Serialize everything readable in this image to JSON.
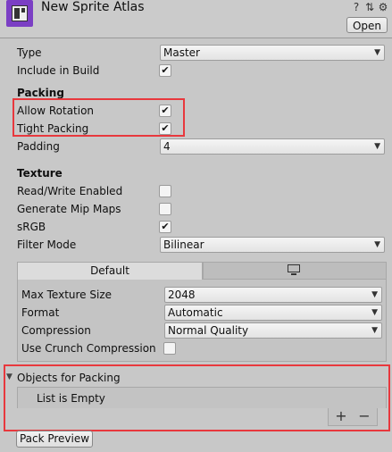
{
  "header": {
    "title": "New Sprite Atlas",
    "icons": [
      "help-icon",
      "preset-icon",
      "gear-icon"
    ],
    "open_label": "Open"
  },
  "properties": {
    "type": {
      "label": "Type",
      "value": "Master"
    },
    "include_in_build": {
      "label": "Include in Build",
      "checked": true
    }
  },
  "packing": {
    "heading": "Packing",
    "allow_rotation": {
      "label": "Allow Rotation",
      "checked": true
    },
    "tight_packing": {
      "label": "Tight Packing",
      "checked": true
    },
    "padding": {
      "label": "Padding",
      "value": "4"
    }
  },
  "texture": {
    "heading": "Texture",
    "read_write": {
      "label": "Read/Write Enabled",
      "checked": false
    },
    "mip_maps": {
      "label": "Generate Mip Maps",
      "checked": false
    },
    "srgb": {
      "label": "sRGB",
      "checked": true
    },
    "filter_mode": {
      "label": "Filter Mode",
      "value": "Bilinear"
    }
  },
  "platform": {
    "tabs": [
      {
        "label": "Default",
        "selected": true
      },
      {
        "label": "",
        "icon": "monitor-icon",
        "selected": false
      }
    ],
    "max_texture_size": {
      "label": "Max Texture Size",
      "value": "2048"
    },
    "format": {
      "label": "Format",
      "value": "Automatic"
    },
    "compression": {
      "label": "Compression",
      "value": "Normal Quality"
    },
    "crunch": {
      "label": "Use Crunch Compression",
      "checked": false
    }
  },
  "objects": {
    "heading": "Objects for Packing",
    "empty_text": "List is Empty",
    "add": "+",
    "remove": "−"
  },
  "pack_preview_label": "Pack Preview",
  "colors": {
    "highlight": "#e8383d",
    "icon_accent": "#7b3fc4"
  }
}
